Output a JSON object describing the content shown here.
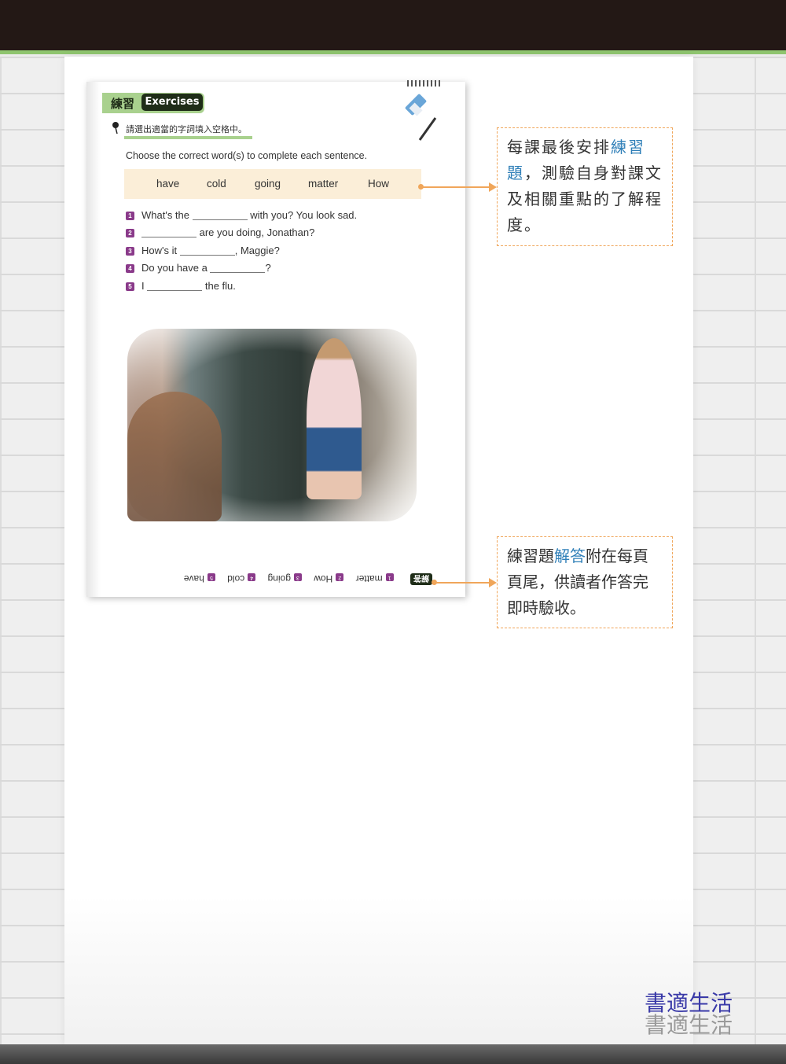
{
  "exercise": {
    "title_zh": "練習",
    "title_en": "Exercises",
    "instruction_zh": "請選出適當的字詞填入空格中。",
    "instruction_en": "Choose the correct word(s) to complete each sentence.",
    "word_bank": [
      "have",
      "cold",
      "going",
      "matter",
      "How"
    ],
    "questions": [
      {
        "num": "1",
        "before": "What's the",
        "after": "with you? You look sad."
      },
      {
        "num": "2",
        "before": "",
        "after": "are you doing, Jonathan?"
      },
      {
        "num": "3",
        "before": "How's it",
        "after": ", Maggie?"
      },
      {
        "num": "4",
        "before": "Do you have a",
        "after": "?"
      },
      {
        "num": "5",
        "before": "I",
        "after": "the flu."
      }
    ],
    "answers_label": "解答",
    "answers": [
      {
        "num": "1",
        "text": "matter"
      },
      {
        "num": "2",
        "text": "How"
      },
      {
        "num": "3",
        "text": "going"
      },
      {
        "num": "4",
        "text": "cold"
      },
      {
        "num": "5",
        "text": "have"
      }
    ]
  },
  "callouts": {
    "first": {
      "part1": "每課最後安排",
      "highlight": "練習題",
      "part2": "，測驗自身對課文及相關重點的了解程度。"
    },
    "second": {
      "part1": "練習題",
      "highlight": "解答",
      "part2": "附在每頁頁尾，供讀者作答完即時驗收。"
    }
  },
  "brand": {
    "line1": "書適生活",
    "line2": "書適生活"
  },
  "colors": {
    "accent_green": "#a9d18e",
    "callout_orange": "#f0a65a",
    "highlight_blue": "#2f7fb8",
    "number_purple": "#8a3a8a"
  }
}
